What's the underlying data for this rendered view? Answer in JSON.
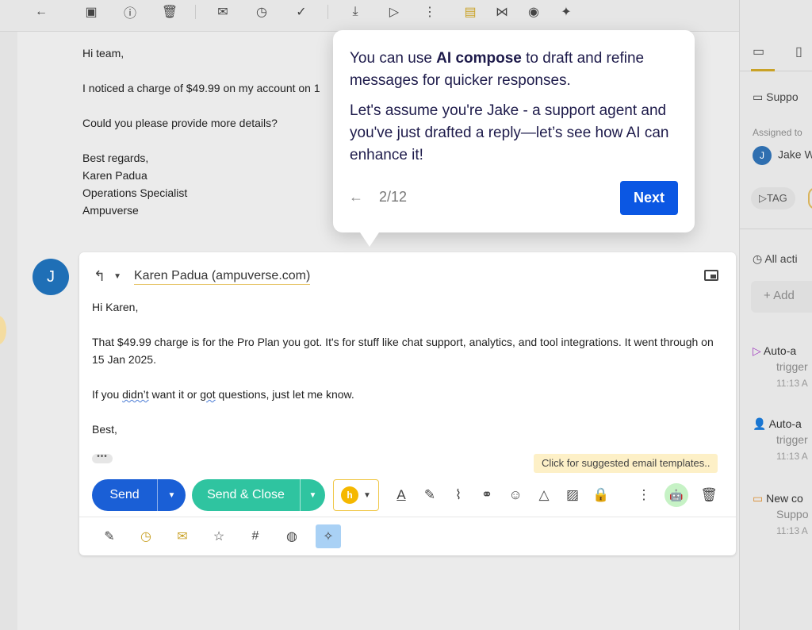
{
  "popover": {
    "line1_pre": "You can use ",
    "line1_bold": "AI compose",
    "line1_post": " to draft and refine messages for quicker responses.",
    "line2": "Let's assume you're Jake - a support agent and you've just drafted a reply—let’s see how AI can enhance it!",
    "step": "2/12",
    "next_label": "Next"
  },
  "original_email": {
    "greeting": "Hi team,",
    "line1": "I noticed a charge of $49.99 on my account on 1",
    "line2": "Could you please provide more details?",
    "sign1": "Best regards,",
    "sign2": "Karen Padua",
    "sign3": "Operations Specialist",
    "sign4": "Ampuverse"
  },
  "avatar_initial": "J",
  "compose": {
    "recipient": "Karen Padua (ampuverse.com)",
    "greeting": "Hi Karen,",
    "para1": "That $49.99 charge is for the Pro Plan you got. It's for stuff like chat support, analytics, and tool integrations. It went through on 15 Jan 2025.",
    "para2_a": "If you ",
    "para2_w1": "didn’t",
    "para2_b": " want it or ",
    "para2_w2": "got",
    "para2_c": " questions, just let me know.",
    "closing": "Best,",
    "template_hint": "Click for suggested email templates..",
    "send_label": "Send",
    "send_close_label": "Send & Close"
  },
  "right_panel": {
    "inbox_label": "Suppo",
    "assigned_label": "Assigned to",
    "assignee": "Jake W",
    "assignee_initial": "J",
    "tag_label": "TAG",
    "activity_label": "All acti",
    "add_label": "Add",
    "activities": [
      {
        "title": "Auto-a",
        "sub": "trigger",
        "time": "11:13 A"
      },
      {
        "title": "Auto-a",
        "sub": "trigger",
        "time": "11:13 A"
      },
      {
        "title": "New co",
        "sub": "Suppo",
        "time": "11:13 A"
      }
    ]
  }
}
